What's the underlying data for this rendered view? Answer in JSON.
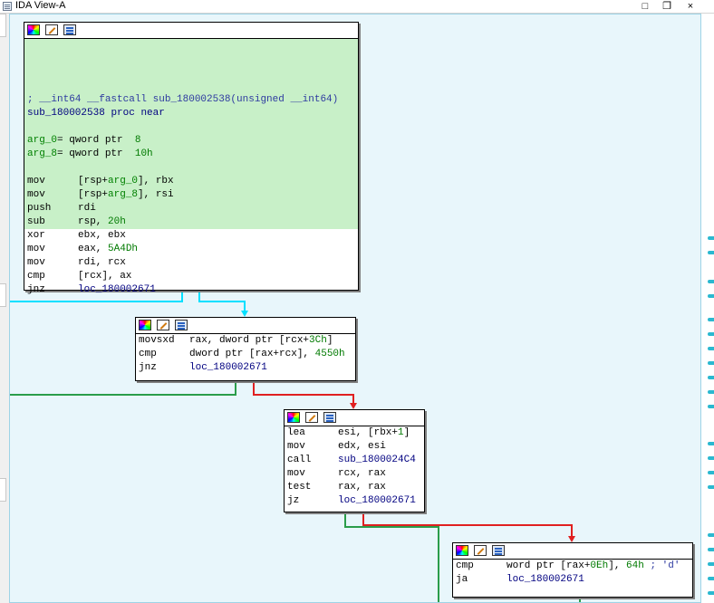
{
  "window": {
    "title": "IDA View-A",
    "buttons": {
      "restore": "❐",
      "maximize": "□",
      "close": "×"
    }
  },
  "node_icons": [
    "color-palette-icon",
    "edit-node-icon",
    "graph-icon"
  ],
  "colors": {
    "graph_background": "#e8f6fb",
    "highlight": "#c8f0c8",
    "edge_jump_taken": "#2a9d4a",
    "edge_jump_not_taken": "#e02020",
    "edge_unconditional": "#00e0ff"
  },
  "blocks": {
    "b1": {
      "comment": "; __int64 __fastcall sub_180002538(unsigned __int64)",
      "proc_name": "sub_180002538",
      "proc_kw": "proc near",
      "args": [
        {
          "name": "arg_0",
          "decl": "= qword ptr",
          "value": "8"
        },
        {
          "name": "arg_8",
          "decl": "= qword ptr",
          "value": "10h"
        }
      ],
      "instr": [
        {
          "op": "mov",
          "a": "[rsp+",
          "arg": "arg_0",
          "b": "], rbx"
        },
        {
          "op": "mov",
          "a": "[rsp+",
          "arg": "arg_8",
          "b": "], rsi"
        },
        {
          "op": "push",
          "a": "rdi"
        },
        {
          "op": "sub",
          "a": "rsp, ",
          "num": "20h"
        },
        {
          "op": "xor",
          "a": "ebx, ebx"
        },
        {
          "op": "mov",
          "a": "eax, ",
          "num": "5A4Dh"
        },
        {
          "op": "mov",
          "a": "rdi, rcx"
        },
        {
          "op": "cmp",
          "a": "[rcx], ax"
        },
        {
          "op": "jnz",
          "a": "loc_180002671"
        }
      ]
    },
    "b2": {
      "instr": [
        {
          "op": "movsxd",
          "a": "rax, dword ptr [rcx+",
          "num": "3Ch",
          "b": "]"
        },
        {
          "op": "cmp",
          "a": "dword ptr [rax+rcx], ",
          "num": "4550h"
        },
        {
          "op": "jnz",
          "a": "loc_180002671"
        }
      ]
    },
    "b3": {
      "instr": [
        {
          "op": "lea",
          "a": "esi, [rbx+",
          "num": "1",
          "b": "]"
        },
        {
          "op": "mov",
          "a": "edx, esi"
        },
        {
          "op": "call",
          "a": "sub_1800024C4"
        },
        {
          "op": "mov",
          "a": "rcx, rax"
        },
        {
          "op": "test",
          "a": "rax, rax"
        },
        {
          "op": "jz",
          "a": "loc_180002671"
        }
      ]
    },
    "b4": {
      "instr": [
        {
          "op": "cmp",
          "a": "word ptr [rax+",
          "num": "0Eh",
          "b": "], ",
          "num2": "64h",
          "c": " ; 'd'"
        },
        {
          "op": "ja",
          "a": "loc_180002671"
        }
      ]
    }
  }
}
